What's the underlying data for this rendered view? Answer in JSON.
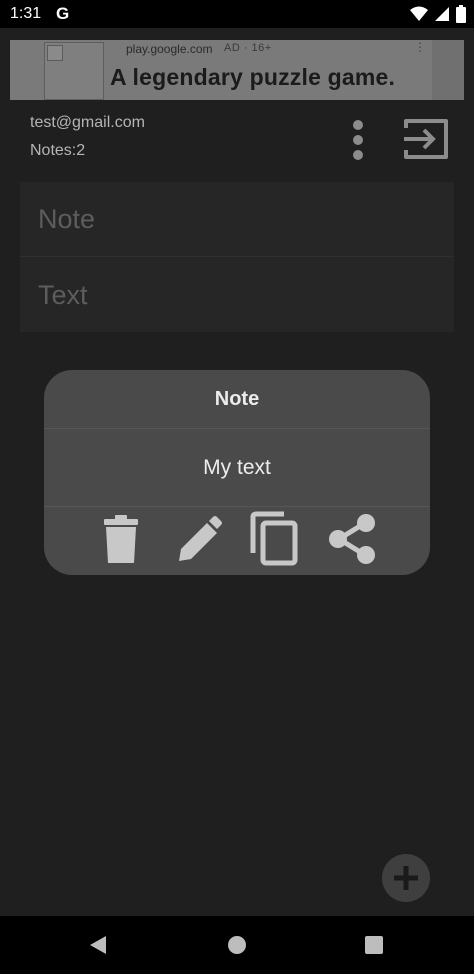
{
  "status_bar": {
    "time": "1:31",
    "g_label": "G"
  },
  "ad": {
    "domain": "play.google.com",
    "badge": "AD · 16+",
    "menu": "⋮",
    "headline": "A legendary puzzle game."
  },
  "account": {
    "email": "test@gmail.com",
    "notes_count": "Notes:2"
  },
  "note_list": [
    {
      "label": "Note"
    },
    {
      "label": "Text"
    }
  ],
  "dialog": {
    "title": "Note",
    "body": "My text",
    "actions": [
      "trash-icon",
      "pencil-icon",
      "copy-icon",
      "share-icon"
    ]
  },
  "colors": {
    "background": "#1f1f1f",
    "dialog": "#4a4a4a",
    "ad_background": "#7a7a7a"
  }
}
